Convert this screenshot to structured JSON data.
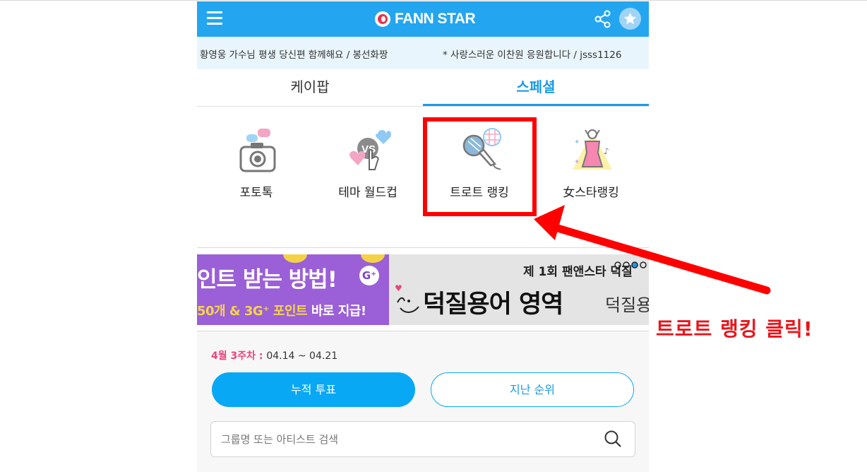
{
  "header": {
    "logo_text": "FANN STAR",
    "menu_icon": "hamburger-menu-icon",
    "share_icon": "share-icon",
    "star_icon": "star-icon"
  },
  "ticker": {
    "messages": [
      "황영웅 가수님 평생 당신편 함께해요 / 봉선화짱",
      "* 사랑스러운 이찬원 응원합니다 / jsss1126"
    ]
  },
  "tabs": [
    {
      "label": "케이팝",
      "active": false
    },
    {
      "label": "스페셜",
      "active": true
    }
  ],
  "categories": [
    {
      "label": "포토톡",
      "icon": "photo-talk-icon"
    },
    {
      "label": "테마 월드컵",
      "icon": "vs-hearts-icon"
    },
    {
      "label": "트로트 랭킹",
      "icon": "microphone-icon"
    },
    {
      "label": "女스타랭킹",
      "icon": "female-star-icon"
    }
  ],
  "banners": {
    "left": {
      "line1": "인트 받는 방법!",
      "badge": "G⁺",
      "line2_highlight": "50개 & 3G⁺ 포인트",
      "line2_rest": " 바로 지급!"
    },
    "right": {
      "line1": "제 1회 팬앤스타 덕질",
      "line2": "덕질용어 영역",
      "line2_side": "덕질용"
    }
  },
  "ranking": {
    "week_label": "4월 3주차 : ",
    "week_range": "04.14 ~ 04.21",
    "vote_button": "누적 투표",
    "past_button": "지난 순위",
    "search_placeholder": "그룹명 또는 아티스트 검색"
  },
  "annotation": {
    "text": "트로트 랭킹 클릭!",
    "color": "#e8161c"
  },
  "colors": {
    "brand_blue": "#23a6ef",
    "accent_pink": "#e8467a",
    "highlight_red": "#ff0000"
  }
}
